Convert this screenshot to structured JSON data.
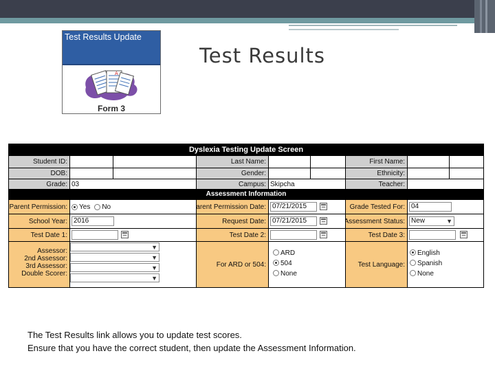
{
  "button_image": {
    "header": "Test Results Update",
    "footer": "Form 3"
  },
  "slide_title": "Test Results",
  "form": {
    "title": "Dyslexia Testing Update Screen",
    "row1": {
      "student_id": "Student ID:",
      "last_name": "Last Name:",
      "first_name": "First Name:"
    },
    "row2": {
      "dob": "DOB:",
      "gender": "Gender:",
      "ethnicity": "Ethnicity:"
    },
    "row3": {
      "grade_label": "Grade:",
      "grade_value": "03",
      "campus_label": "Campus:",
      "campus_value": "Skipcha",
      "teacher_label": "Teacher:"
    },
    "section_title": "Assessment Information",
    "parent_permission": {
      "label": "Parent Permission:",
      "yes": "Yes",
      "no": "No"
    },
    "permission_date": {
      "label": "Parent Permission Date:",
      "value": "07/21/2015"
    },
    "grade_tested": {
      "label": "Grade Tested For:",
      "value": "04"
    },
    "school_year": {
      "label": "School Year:",
      "value": "2016"
    },
    "request_date": {
      "label": "Request Date:",
      "value": "07/21/2015"
    },
    "assessment_status": {
      "label": "Assessment Status:",
      "value": "New"
    },
    "test_date1": {
      "label": "Test Date 1:"
    },
    "test_date2": {
      "label": "Test Date 2:"
    },
    "test_date3": {
      "label": "Test Date 3:"
    },
    "assessors": {
      "assessor": "Assessor:",
      "second": "2nd Assessor:",
      "third": "3rd Assessor:",
      "double": "Double Scorer:"
    },
    "ard_504": {
      "label": "For ARD or 504:",
      "options": [
        "ARD",
        "504",
        "None"
      ],
      "selected": "504"
    },
    "test_language": {
      "label": "Test Language:",
      "options": [
        "English",
        "Spanish",
        "None"
      ],
      "selected": "English"
    }
  },
  "caption": {
    "line1": "The Test Results link allows you to update test scores.",
    "line2": "Ensure that you have the correct student, then update the Assessment Information."
  }
}
